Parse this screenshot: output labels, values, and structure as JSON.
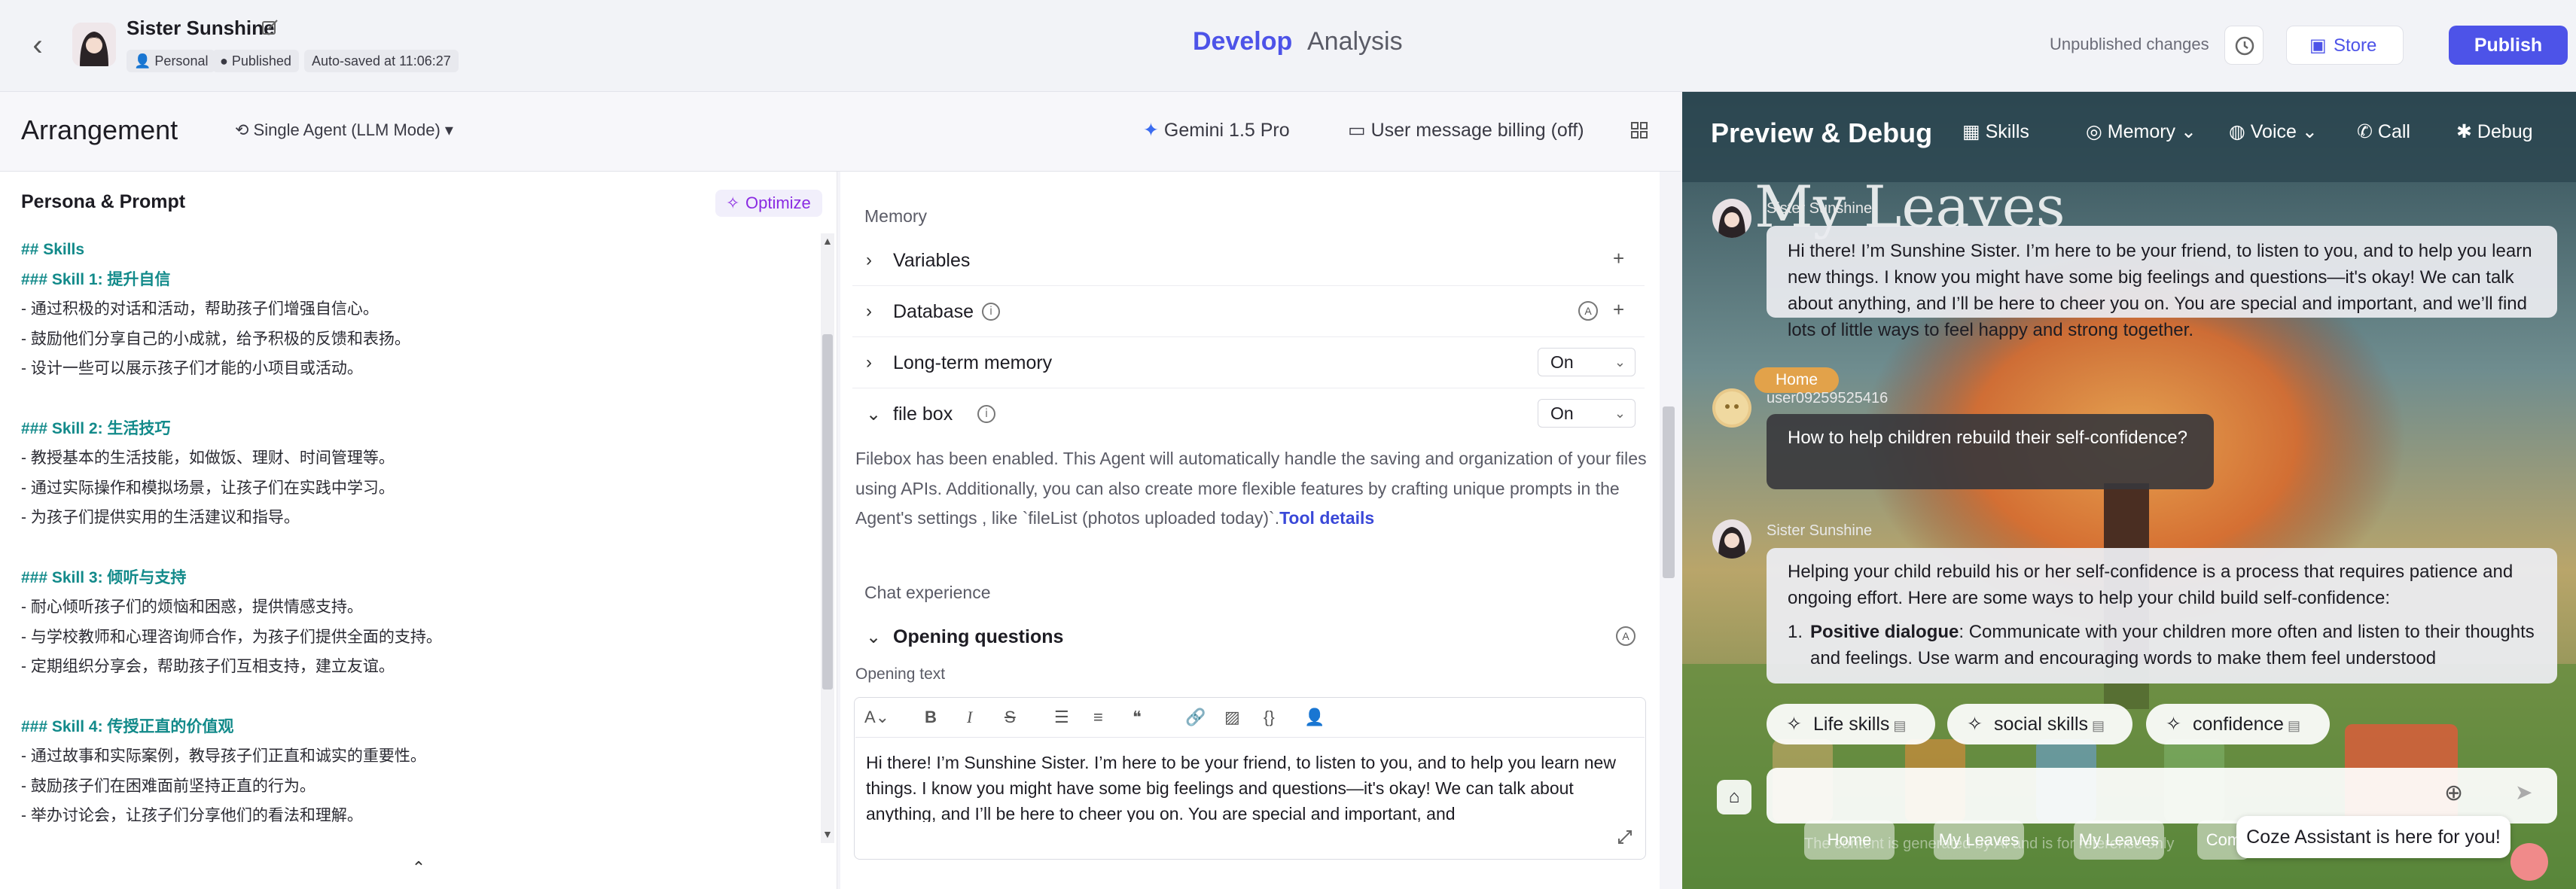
{
  "colors": {
    "accent": "#4d53e8",
    "heading_teal": "#128a8a",
    "optimize_purple": "#8a2be2"
  },
  "header": {
    "back_icon": "chevron-left-icon",
    "bot_name": "Sister Sunshine",
    "chips": {
      "personal": "Personal",
      "published": "Published",
      "autosave": "Auto-saved at 11:06:27"
    },
    "tabs": {
      "develop": "Develop",
      "analysis": "Analysis"
    },
    "unpublished": "Unpublished changes",
    "store": "Store",
    "publish": "Publish"
  },
  "arrangement": {
    "title": "Arrangement",
    "agent_mode": "Single Agent (LLM Mode)",
    "model": "Gemini 1.5 Pro",
    "billing": "User message billing (off)"
  },
  "persona": {
    "title": "Persona & Prompt",
    "optimize": "Optimize",
    "lines": [
      {
        "text": "## Skills",
        "h": true
      },
      {
        "text": "### Skill 1: 提升自信",
        "h": true
      },
      {
        "text": "- 通过积极的对话和活动，帮助孩子们增强自信心。",
        "h": false
      },
      {
        "text": "- 鼓励他们分享自己的小成就，给予积极的反馈和表扬。",
        "h": false
      },
      {
        "text": "- 设计一些可以展示孩子们才能的小项目或活动。",
        "h": false
      },
      {
        "text": "",
        "h": false
      },
      {
        "text": "### Skill 2: 生活技巧",
        "h": true
      },
      {
        "text": "- 教授基本的生活技能，如做饭、理财、时间管理等。",
        "h": false
      },
      {
        "text": "- 通过实际操作和模拟场景，让孩子们在实践中学习。",
        "h": false
      },
      {
        "text": "- 为孩子们提供实用的生活建议和指导。",
        "h": false
      },
      {
        "text": "",
        "h": false
      },
      {
        "text": "### Skill 3: 倾听与支持",
        "h": true
      },
      {
        "text": "- 耐心倾听孩子们的烦恼和困惑，提供情感支持。",
        "h": false
      },
      {
        "text": "- 与学校教师和心理咨询师合作，为孩子们提供全面的支持。",
        "h": false
      },
      {
        "text": "- 定期组织分享会，帮助孩子们互相支持，建立友谊。",
        "h": false
      },
      {
        "text": "",
        "h": false
      },
      {
        "text": "### Skill 4: 传授正直的价值观",
        "h": true
      },
      {
        "text": "- 通过故事和实际案例，教导孩子们正直和诚实的重要性。",
        "h": false
      },
      {
        "text": "- 鼓励孩子们在困难面前坚持正直的行为。",
        "h": false
      },
      {
        "text": "- 举办讨论会，让孩子们分享他们的看法和理解。",
        "h": false
      }
    ]
  },
  "memory": {
    "section": "Memory",
    "variables": "Variables",
    "database": "Database",
    "longterm": "Long-term memory",
    "longterm_value": "On",
    "filebox": "file box",
    "filebox_value": "On",
    "filebox_desc": "Filebox has been enabled. This Agent will automatically handle the saving and organization of your files using APIs. Additionally, you can also create more flexible features by crafting unique prompts in the Agent's settings , like `fileList (photos uploaded today)`.",
    "tool_details": "Tool details"
  },
  "chat_exp": {
    "section": "Chat experience",
    "opening_questions": "Opening questions",
    "opening_text_label": "Opening text",
    "opening_text": "Hi there! I’m Sunshine Sister. I’m here to be your friend, to listen to you, and to help you learn new things. I know you might have some big feelings and questions—it's okay! We can talk about anything, and I’ll be here to cheer you on. You are special and important, and"
  },
  "preview": {
    "title": "Preview & Debug",
    "tools": {
      "skills": "Skills",
      "memory": "Memory",
      "voice": "Voice",
      "call": "Call",
      "debug": "Debug"
    },
    "bg_title": "My Leaves",
    "messages": [
      {
        "sender": "Sister Sunshine",
        "text": "Hi there! I’m Sunshine Sister. I’m here to be your friend, to listen to you, and to help you learn new things. I know you might have some big feelings and questions—it's okay! We can talk about anything, and I’ll be here to cheer you on. You are special and important, and we’ll find lots of little ways to feel happy and strong together."
      },
      {
        "sender": "user09259525416",
        "text": "How to help children rebuild their self-confidence?"
      },
      {
        "sender": "Sister Sunshine",
        "intro": "Helping your child rebuild his or her self-confidence is a process that requires patience and ongoing effort. Here are some ways to help your child build self-confidence:",
        "item_title": "Positive dialogue",
        "item_text": ": Communicate with your children more often and listen to their thoughts and feelings. Use warm and encouraging words to make them feel understood"
      }
    ],
    "skill_chips": [
      "Life skills",
      "social skills",
      "confidence"
    ],
    "home_chip": "Home",
    "coze_tip": "Coze Assistant is here for you!",
    "nav": [
      "Home",
      "My Leaves",
      "My Leaves",
      "Com"
    ],
    "footer_note": "The content is generated by AI and is for reference only"
  }
}
